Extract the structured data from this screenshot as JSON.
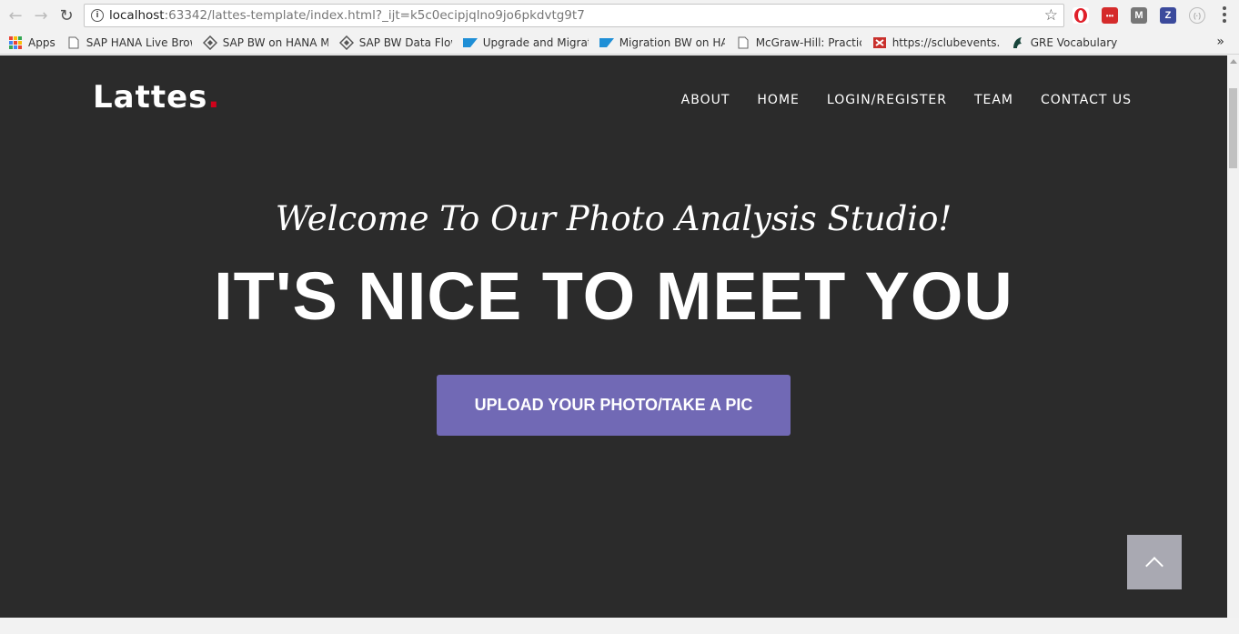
{
  "browser": {
    "url_host": "localhost",
    "url_rest": ":63342/lattes-template/index.html?_ijt=k5c0ecipjqlno9jo6pkdvtg9t7",
    "bookmarks": [
      {
        "label": "Apps",
        "icon": "apps-grid-icon"
      },
      {
        "label": "SAP HANA Live Brow",
        "icon": "page-icon"
      },
      {
        "label": "SAP BW on HANA M",
        "icon": "diamond-icon"
      },
      {
        "label": "SAP BW Data Flow",
        "icon": "diamond-icon"
      },
      {
        "label": "Upgrade and Migrati",
        "icon": "sap-icon"
      },
      {
        "label": "Migration BW on HA",
        "icon": "sap-icon"
      },
      {
        "label": "McGraw-Hill: Practice",
        "icon": "page-icon"
      },
      {
        "label": "https://sclubevents.cc",
        "icon": "sclub-icon"
      },
      {
        "label": "GRE Vocabulary",
        "icon": "spartan-icon"
      }
    ],
    "more_bookmarks": "»",
    "extensions": [
      {
        "name": "opera-icon",
        "color": "#e0202a",
        "glyph": "O"
      },
      {
        "name": "dots-extension-icon",
        "color": "#d52b2b",
        "glyph": "•••"
      },
      {
        "name": "m-extension-icon",
        "color": "#777777",
        "glyph": "M"
      },
      {
        "name": "zotero-icon",
        "color": "#3b4a9c",
        "glyph": "Z"
      },
      {
        "name": "ring-extension-icon",
        "color": "#bbbbbb",
        "glyph": "(·)"
      }
    ]
  },
  "site": {
    "logo": "Lattes",
    "logo_dot": ".",
    "nav": [
      "ABOUT",
      "HOME",
      "LOGIN/REGISTER",
      "TEAM",
      "CONTACT US"
    ],
    "welcome": "Welcome To Our Photo Analysis Studio!",
    "headline": "IT'S NICE TO MEET YOU",
    "cta": "UPLOAD YOUR PHOTO/TAKE A PIC"
  },
  "colors": {
    "page_bg": "#2b2b2b",
    "accent_button": "#7169b5",
    "logo_dot": "#d0021b",
    "scroll_top_button": "#a9a9b2"
  }
}
